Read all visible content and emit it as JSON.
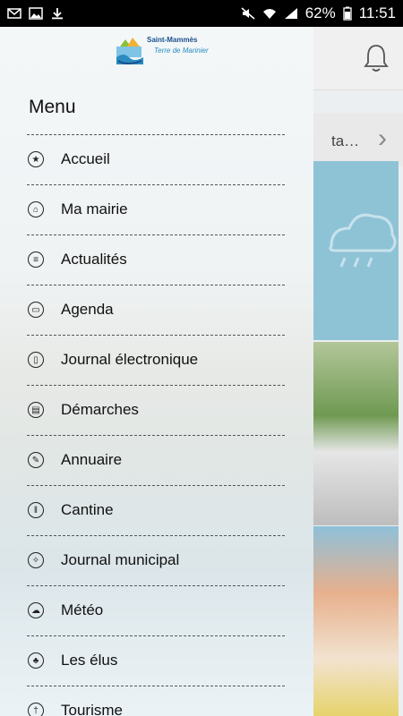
{
  "status_bar": {
    "battery": "62%",
    "time": "11:51"
  },
  "background": {
    "news_text": "ta…"
  },
  "logo": {
    "title": "Saint-Mammès",
    "subtitle": "Terre de Marinier"
  },
  "menu": {
    "heading": "Menu",
    "items": [
      {
        "label": "Accueil",
        "icon": "star-icon"
      },
      {
        "label": "Ma mairie",
        "icon": "town-hall-icon"
      },
      {
        "label": "Actualités",
        "icon": "news-icon"
      },
      {
        "label": "Agenda",
        "icon": "calendar-icon"
      },
      {
        "label": "Journal électronique",
        "icon": "journal-icon"
      },
      {
        "label": "Démarches",
        "icon": "procedures-icon"
      },
      {
        "label": "Annuaire",
        "icon": "directory-icon"
      },
      {
        "label": "Cantine",
        "icon": "cutlery-icon"
      },
      {
        "label": "Journal municipal",
        "icon": "municipal-journal-icon"
      },
      {
        "label": "Météo",
        "icon": "weather-icon"
      },
      {
        "label": "Les élus",
        "icon": "elected-officials-icon"
      },
      {
        "label": "Tourisme",
        "icon": "tourism-icon"
      }
    ]
  }
}
